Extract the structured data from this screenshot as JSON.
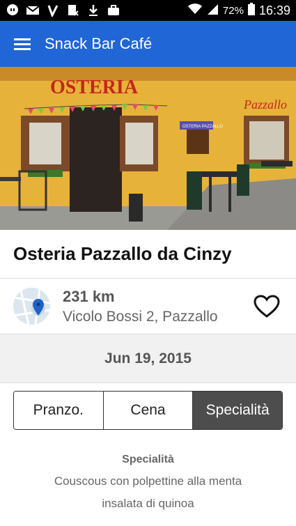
{
  "statusbar": {
    "battery": "72%",
    "time": "16:39"
  },
  "app": {
    "title": "Snack Bar Café"
  },
  "hero": {
    "sign_main": "OSTERIA",
    "sign_side": "Pazzallo",
    "sign_small": "OSTERIA PAZZALLO"
  },
  "place": {
    "name": "Osteria Pazzallo da Cinzy",
    "distance": "231 km",
    "address": "Vicolo Bossi 2, Pazzallo"
  },
  "date": "Jun 19, 2015",
  "tabs": [
    {
      "label": "Pranzo."
    },
    {
      "label": "Cena"
    },
    {
      "label": "Specialità"
    }
  ],
  "menu": {
    "title": "Specialità",
    "items": [
      "Couscous con polpettine alla menta",
      "insalata di quinoa"
    ]
  }
}
